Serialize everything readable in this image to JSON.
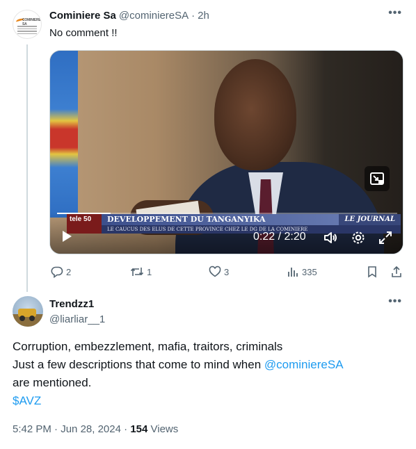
{
  "parent_tweet": {
    "author_name": "Cominiere Sa",
    "author_handle": "@cominiereSA",
    "separator": "·",
    "time_ago": "2h",
    "text": "No comment !!",
    "video": {
      "chyron_channel": "tele 50",
      "chyron_title": "DEVELOPPEMENT DU TANGANYIKA",
      "chyron_right": "LE JOURNAL",
      "chyron_subtitle": "LE CAUCUS DES ELUS DE CETTE PROVINCE CHEZ LE DG DE LA COMINIERE",
      "timecode": "0:22 / 2:20",
      "progress": 0.157
    },
    "actions": {
      "replies": "2",
      "reposts": "1",
      "likes": "3",
      "views": "335"
    }
  },
  "main_tweet": {
    "author_name": "Trendzz1",
    "author_handle": "@liarliar__1",
    "line1": "Corruption, embezzlement, mafia, traitors, criminals",
    "line2_prefix": "Just a few descriptions that come to mind when ",
    "mention": "@cominiereSA",
    "line3": "are mentioned.",
    "cashtag": "$AVZ",
    "time": "5:42 PM",
    "date": "Jun 28, 2024",
    "meta_sep": " · ",
    "views_count": "154",
    "views_label": "Views"
  },
  "colors": {
    "accent": "#1d9bf0",
    "muted": "#536471",
    "text": "#0f1419",
    "thread_line": "#cfd9de"
  },
  "icons": [
    "more-icon",
    "reply-icon",
    "repost-icon",
    "like-icon",
    "views-icon",
    "bookmark-icon",
    "share-icon",
    "play-icon",
    "volume-icon",
    "settings-icon",
    "fullscreen-icon",
    "picture-in-picture-icon"
  ]
}
